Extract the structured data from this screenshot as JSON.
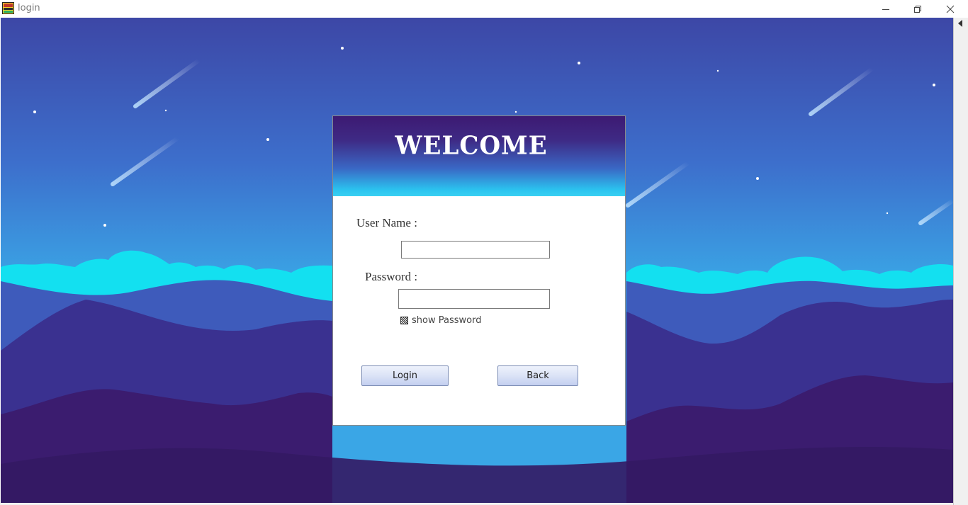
{
  "window": {
    "title": "login"
  },
  "dialog": {
    "heading": "WELCOME",
    "username_label": "User Name :",
    "username_value": "",
    "password_label": "Password :",
    "password_value": "",
    "show_password_label": "show Password",
    "show_password_checked": false,
    "login_label": "Login",
    "back_label": "Back"
  },
  "colors": {
    "sky_top": "#3d47a6",
    "sky_bottom": "#3aa6e6",
    "cloud": "#13e0f0",
    "hill_far": "#3e5bbb",
    "hill_mid": "#3a3190",
    "hill_near": "#3b1c6f",
    "header_top": "#3d1a72",
    "header_bottom": "#3ad0f2"
  }
}
